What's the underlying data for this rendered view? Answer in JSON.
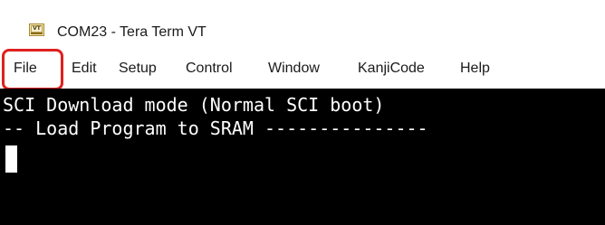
{
  "window": {
    "title": "COM23 - Tera Term VT",
    "icon": "tera-term-vt-icon",
    "icon_text": "VT"
  },
  "menu": {
    "items": [
      {
        "label": "File",
        "highlighted": true
      },
      {
        "label": "Edit"
      },
      {
        "label": "Setup"
      },
      {
        "label": "Control"
      },
      {
        "label": "Window"
      },
      {
        "label": "KanjiCode"
      },
      {
        "label": "Help"
      }
    ]
  },
  "terminal": {
    "lines": [
      "SCI Download mode (Normal SCI boot)",
      "-- Load Program to SRAM ---------------"
    ],
    "background": "#000000",
    "foreground": "#ffffff"
  },
  "annotation": {
    "highlight_color": "#e02020",
    "highlight_target": "File"
  }
}
